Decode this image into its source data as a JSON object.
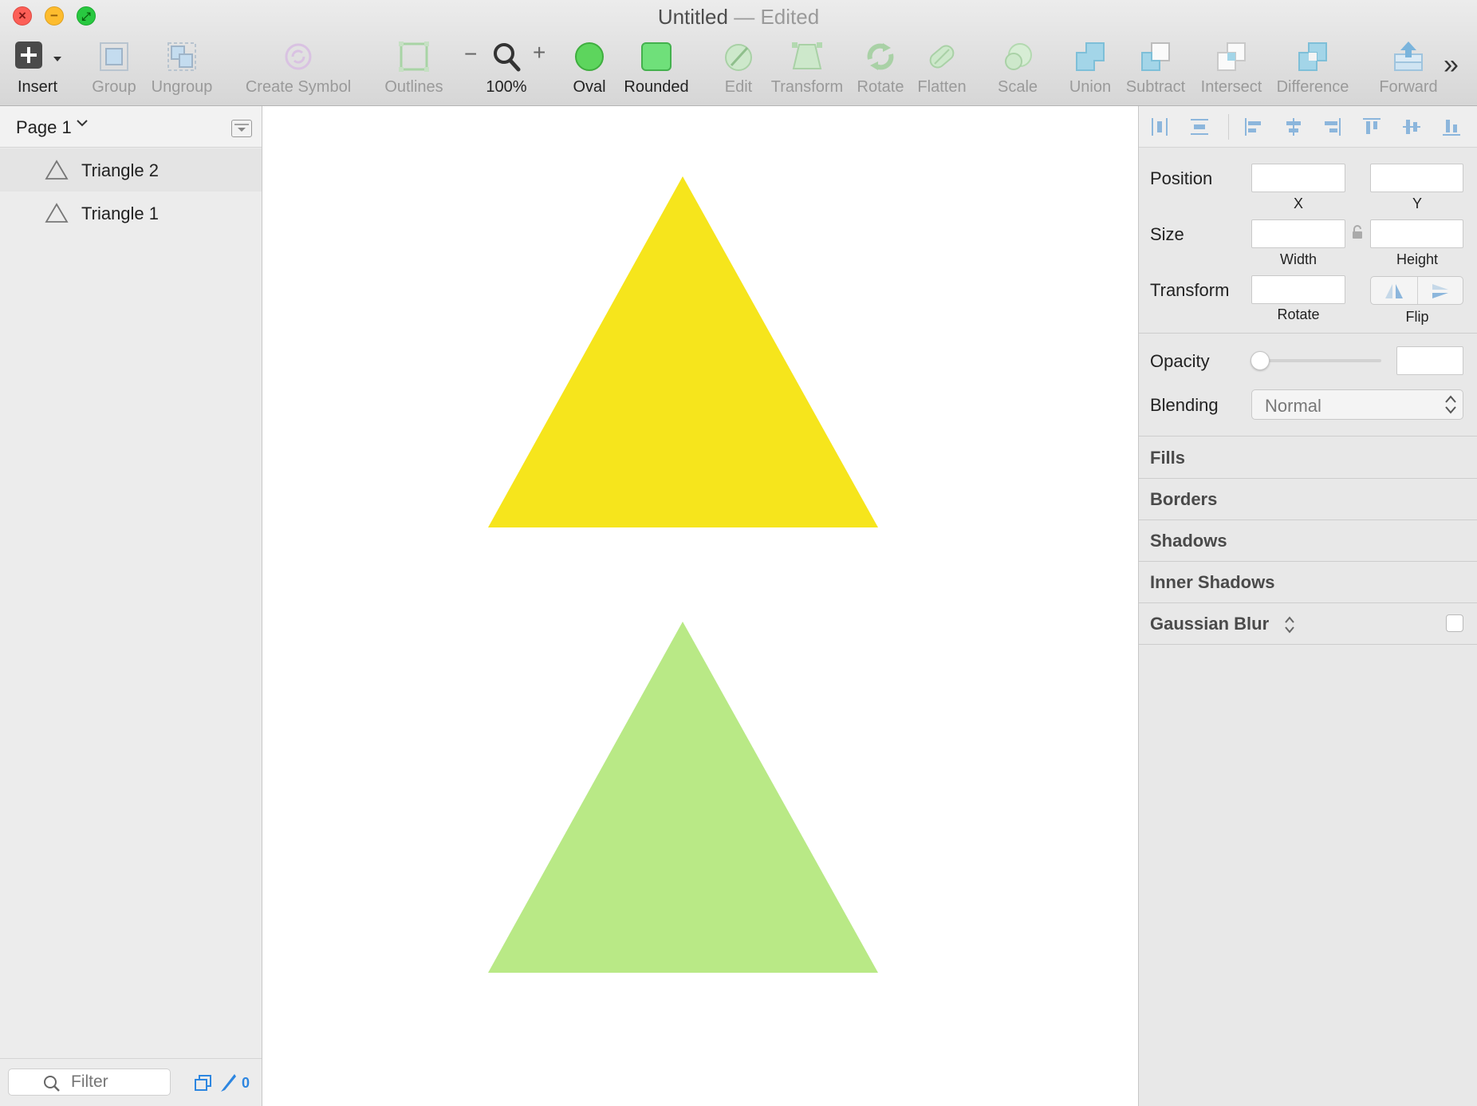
{
  "window": {
    "title": "Untitled",
    "separator": "—",
    "status": "Edited"
  },
  "toolbar": {
    "insert": "Insert",
    "group": "Group",
    "ungroup": "Ungroup",
    "create_symbol": "Create Symbol",
    "outlines": "Outlines",
    "zoom_minus": "−",
    "zoom_plus": "+",
    "zoom": "100%",
    "oval": "Oval",
    "rounded": "Rounded",
    "edit": "Edit",
    "transform": "Transform",
    "rotate": "Rotate",
    "flatten": "Flatten",
    "scale": "Scale",
    "union": "Union",
    "subtract": "Subtract",
    "intersect": "Intersect",
    "difference": "Difference",
    "forward": "Forward",
    "overflow": "»"
  },
  "sidebar": {
    "page": "Page 1",
    "layers": [
      {
        "name": "Triangle 2"
      },
      {
        "name": "Triangle 1"
      }
    ],
    "filter_placeholder": "Filter",
    "slice_count": "0"
  },
  "canvas": {
    "shapes": [
      {
        "name": "Triangle 2",
        "fill": "#f6e51c"
      },
      {
        "name": "Triangle 1",
        "fill": "#b9e986"
      }
    ]
  },
  "inspector": {
    "position": "Position",
    "x": "X",
    "y": "Y",
    "size": "Size",
    "width": "Width",
    "height": "Height",
    "transform": "Transform",
    "rotate": "Rotate",
    "flip": "Flip",
    "opacity": "Opacity",
    "blending": "Blending",
    "blending_value": "Normal",
    "fills": "Fills",
    "borders": "Borders",
    "shadows": "Shadows",
    "inner_shadows": "Inner Shadows",
    "gaussian_blur": "Gaussian Blur"
  },
  "colors": {
    "accent": "#2d86e0",
    "oval": "#5dd55d",
    "rounded": "#6fe07a"
  }
}
